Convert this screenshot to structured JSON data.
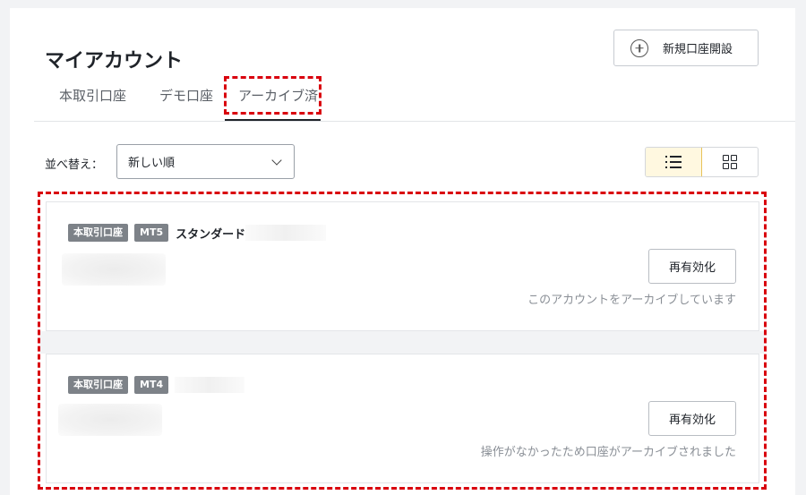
{
  "page_title": "マイアカウント",
  "new_account_button": "新規口座開設",
  "tabs": [
    {
      "label": "本取引口座"
    },
    {
      "label": "デモ口座"
    },
    {
      "label": "アーカイブ済",
      "active": true
    }
  ],
  "sort": {
    "label": "並べ替え：",
    "selected": "新しい順"
  },
  "view_toggle": {
    "active": "list"
  },
  "accounts": [
    {
      "type_badge": "本取引口座",
      "platform_badge": "MT5",
      "plan": "スタンダード",
      "button": "再有効化",
      "status": "このアカウントをアーカイブしています"
    },
    {
      "type_badge": "本取引口座",
      "platform_badge": "MT4",
      "plan": "",
      "button": "再有効化",
      "status": "操作がなかったため口座がアーカイブされました"
    }
  ],
  "colors": {
    "highlight": "#d9000d",
    "badge_bg": "#7d8288",
    "active_view_bg": "#fff8e0"
  }
}
